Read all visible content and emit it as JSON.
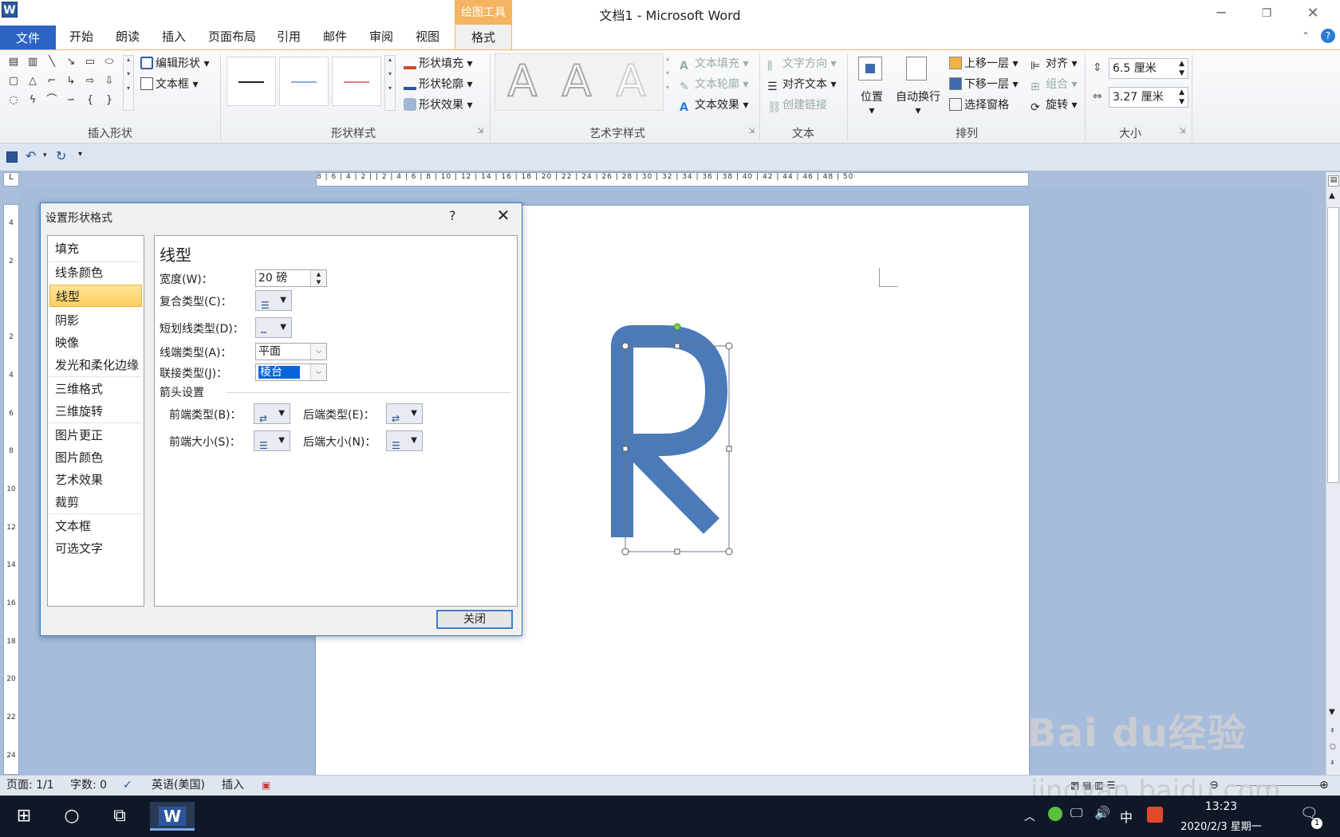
{
  "titlebar": {
    "app_icon": "W",
    "title": "文档1 - Microsoft Word",
    "context_group": "绘图工具",
    "min": "─",
    "restore": "❐",
    "close": "✕"
  },
  "tabs": [
    "文件",
    "开始",
    "朗读",
    "插入",
    "页面布局",
    "引用",
    "邮件",
    "审阅",
    "视图",
    "格式"
  ],
  "ribbon": {
    "insert_shape": {
      "edit_shape": "编辑形状",
      "text_box": "文本框",
      "label": "插入形状"
    },
    "shape_styles": {
      "fill": "形状填充",
      "outline": "形状轮廓",
      "effects": "形状效果",
      "label": "形状样式"
    },
    "wordart": {
      "text_fill": "文本填充",
      "text_outline": "文本轮廓",
      "text_effects": "文本效果",
      "letter": "A",
      "label": "艺术字样式"
    },
    "text": {
      "direction": "文字方向",
      "align_text": "对齐文本",
      "create_link": "创建链接",
      "label": "文本"
    },
    "arrange": {
      "position": "位置",
      "wrap": "自动换行",
      "bring_forward": "上移一层",
      "send_backward": "下移一层",
      "selection_pane": "选择窗格",
      "align": "对齐",
      "group": "组合",
      "rotate": "旋转",
      "label": "排列"
    },
    "size": {
      "height": "6.5 厘米",
      "width": "3.27 厘米",
      "label": "大小"
    }
  },
  "ruler": {
    "ticks": "8 | 6 | 4 | 2 |   | 2 | 4 | 6 | 8 | 10 | 12 | 14 | 16 | 18 | 20 | 22 | 24 | 26 | 28 | 30 | 32 | 34 | 36 | 38 | 40 | 42 | 44 | 46 | 48 | 50",
    "vticks": [
      "4",
      "2",
      "",
      "2",
      "4",
      "6",
      "8",
      "10",
      "12",
      "14",
      "16",
      "18",
      "20",
      "22",
      "24"
    ]
  },
  "dialog": {
    "title": "设置形状格式",
    "help": "?",
    "close_x": "✕",
    "nav": [
      "填充",
      "线条颜色",
      "线型",
      "阴影",
      "映像",
      "发光和柔化边缘",
      "三维格式",
      "三维旋转",
      "图片更正",
      "图片颜色",
      "艺术效果",
      "裁剪",
      "文本框",
      "可选文字"
    ],
    "panel": {
      "heading": "线型",
      "width_label": "宽度(W)：",
      "width_value": "20 磅",
      "compound_label": "复合类型(C)：",
      "dash_label": "短划线类型(D)：",
      "cap_label": "线端类型(A)：",
      "cap_value": "平面",
      "join_label": "联接类型(J)：",
      "join_value": "棱台",
      "arrow_section": "箭头设置",
      "begin_type": "前端类型(B)：",
      "end_type": "后端类型(E)：",
      "begin_size": "前端大小(S)：",
      "end_size": "后端大小(N)："
    },
    "close_button": "关闭"
  },
  "status": {
    "page": "页面: 1/1",
    "words": "字数: 0",
    "language": "英语(美国)",
    "insert": "插入"
  },
  "taskbar": {
    "time": "13:23",
    "date": "2020/2/3 星期一",
    "ime": "中",
    "notif": "1"
  },
  "watermark": {
    "brand": "Bai du经验",
    "url": "jingyan.baidu.com"
  },
  "colors": {
    "accent": "#2b579a",
    "shape": "#4a7ab8",
    "context": "#f5b462"
  }
}
